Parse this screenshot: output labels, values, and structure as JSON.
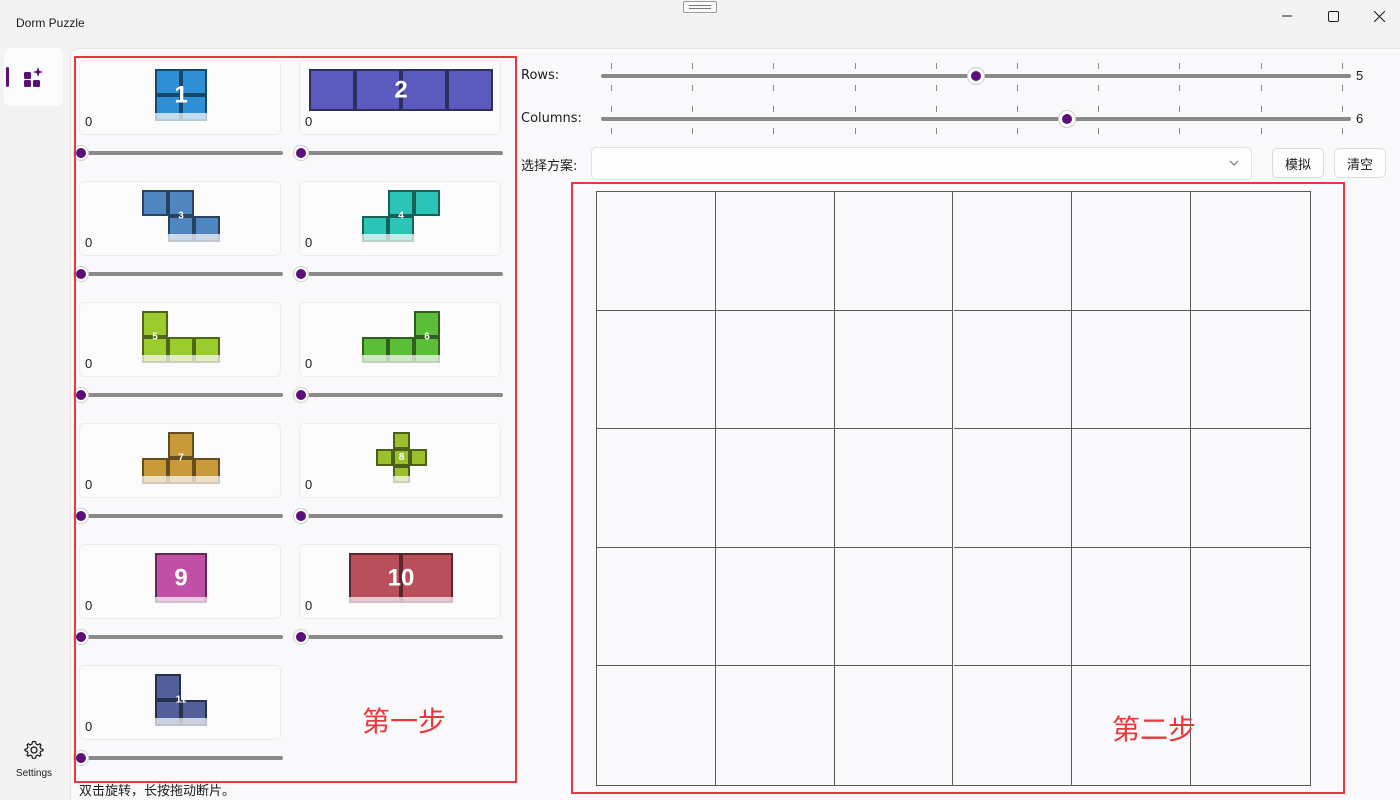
{
  "app": {
    "title": "Dorm Puzzle"
  },
  "nav": {
    "home_icon": "apps-sparkle-icon",
    "settings_label": "Settings",
    "settings_icon": "gear-icon"
  },
  "colors": {
    "accent": "#5c0f79",
    "annotation": "#e8383d",
    "grid_line": "#5a5a5a"
  },
  "pieces": [
    {
      "id": "1",
      "label": "1",
      "count": "0",
      "color": "#2e8fd6",
      "shape": "square-2x2"
    },
    {
      "id": "2",
      "label": "2",
      "count": "0",
      "color": "#5b5bbf",
      "shape": "bar-1x4"
    },
    {
      "id": "3",
      "label": "3",
      "count": "0",
      "color": "#4f86c0",
      "shape": "z-tetromino"
    },
    {
      "id": "4",
      "label": "4",
      "count": "0",
      "color": "#2bc4b6",
      "shape": "s-tetromino"
    },
    {
      "id": "5",
      "label": "5",
      "count": "0",
      "color": "#9acc2e",
      "shape": "j-tetromino"
    },
    {
      "id": "6",
      "label": "6",
      "count": "0",
      "color": "#5bbd3a",
      "shape": "l-tetromino"
    },
    {
      "id": "7",
      "label": "7",
      "count": "0",
      "color": "#c99a3a",
      "shape": "t-tetromino"
    },
    {
      "id": "8",
      "label": "8",
      "count": "0",
      "color": "#9ac02e",
      "shape": "plus"
    },
    {
      "id": "9",
      "label": "9",
      "count": "0",
      "color": "#c04fa6",
      "shape": "square-1x1"
    },
    {
      "id": "10",
      "label": "10",
      "count": "0",
      "color": "#b84f5a",
      "shape": "bar-1x2"
    },
    {
      "id": "11",
      "label": "11",
      "count": "0",
      "color": "#52609a",
      "shape": "small-l"
    }
  ],
  "step1_label": "第一步",
  "step2_label": "第二步",
  "hint": "双击旋转，长按拖动断片。",
  "controls": {
    "rows_label": "Rows:",
    "rows_value": "5",
    "rows_min": 1,
    "rows_max": 9,
    "columns_label": "Columns:",
    "columns_value": "6",
    "columns_min": 1,
    "columns_max": 9,
    "scheme_label": "选择方案:",
    "scheme_value": "",
    "simulate_label": "模拟",
    "clear_label": "清空"
  },
  "board": {
    "rows": 5,
    "columns": 6
  }
}
